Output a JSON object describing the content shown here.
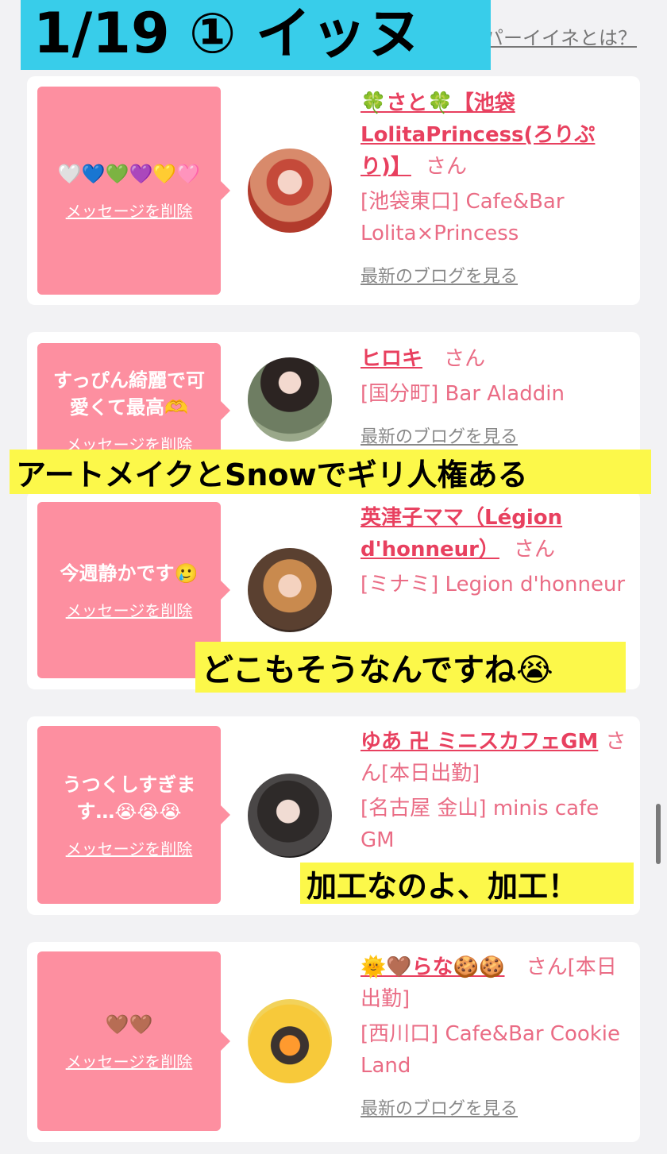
{
  "header": {
    "label": "1/19 ① イッヌ",
    "help_link": "パーイイネとは？"
  },
  "cards": [
    {
      "message": "🤍💙💚💜💛🩷",
      "delete_label": "メッセージを削除",
      "name": "🍀さと🍀【池袋LolitaPrincess(ろりぷり)】",
      "honorific": "さん",
      "shop": "[池袋東口] Cafe&Bar Lolita×Princess",
      "blog_label": "最新のブログを見る"
    },
    {
      "message": "すっぴん綺麗で可愛くて最高🫶",
      "delete_label": "メッセージを削除",
      "name": "ヒロキ",
      "honorific": "さん",
      "shop": "[国分町] Bar Aladdin",
      "blog_label": "最新のブログを見る"
    },
    {
      "message": "今週静かです🥲",
      "delete_label": "メッセージを削除",
      "name": "英津子ママ（Légion d'honneur）",
      "honorific": "さん",
      "shop": "[ミナミ] Legion d'honneur",
      "blog_label": ""
    },
    {
      "message": "うつくしすぎます…😭😭😭",
      "delete_label": "メッセージを削除",
      "name": "ゆあ 卍 ミニスカフェGM",
      "honorific": "さん[本日出勤]",
      "shop": "[名古屋 金山] minis cafe GM",
      "blog_label": ""
    },
    {
      "message": "🤎🤎",
      "delete_label": "メッセージを削除",
      "name": "🌞🤎らな🍪🍪",
      "honorific": "さん[本日出勤]",
      "shop": "[西川口] Cafe&Bar Cookie Land",
      "blog_label": "最新のブログを見る"
    }
  ],
  "captions": [
    "アートメイクとSnowでギリ人権ある",
    "どこもそうなんですね😭",
    "加工なのよ、加工！"
  ],
  "colors": {
    "header_bg": "#38cdea",
    "message_bg": "#fd8fa0",
    "name_color": "#e8405f",
    "caption_bg": "#fcf84a"
  }
}
